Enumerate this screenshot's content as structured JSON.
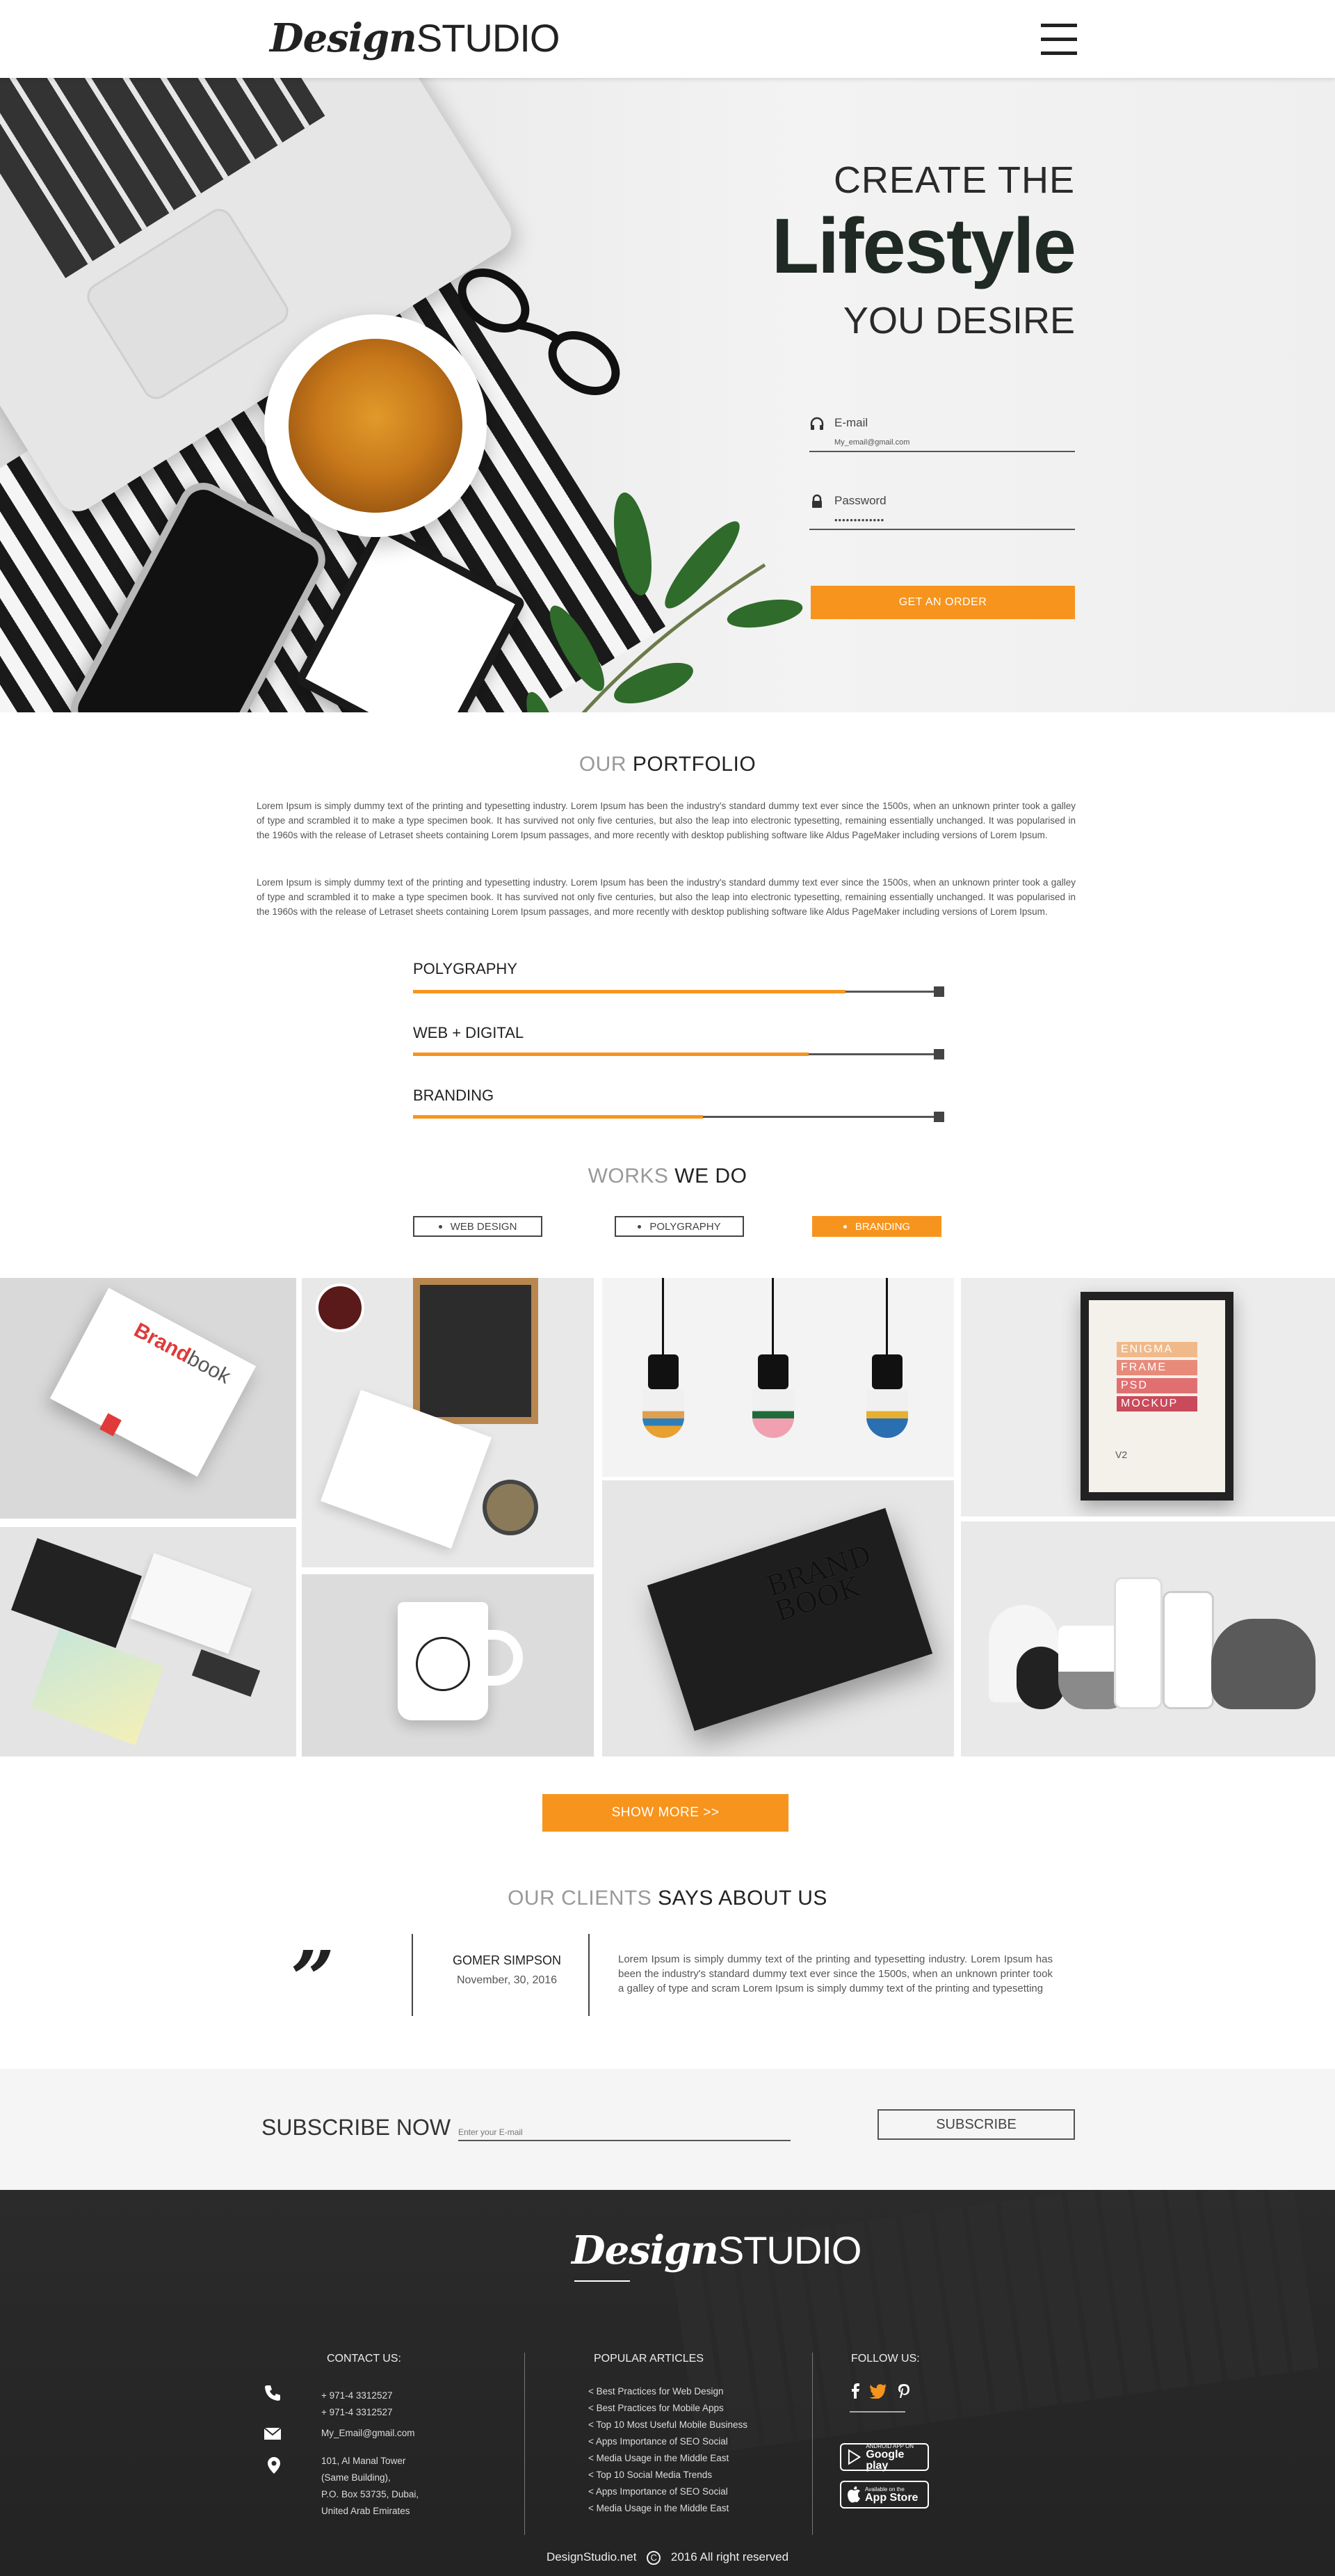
{
  "header": {
    "logo_bold": "Design",
    "logo_thin": "STUDIO"
  },
  "hero": {
    "line1": "CREATE THE",
    "line2": "Lifestyle",
    "line3": "YOU DESIRE",
    "email_label": "E-mail",
    "email_value": "My_email@gmail.com",
    "password_label": "Password",
    "password_value": "•••••••••••••",
    "cta": "GET AN ORDER"
  },
  "portfolio": {
    "title_light": "OUR",
    "title_bold": "PORTFOLIO",
    "para1": "Lorem Ipsum is simply dummy text of the printing and typesetting industry. Lorem Ipsum has been the industry's standard dummy text ever since the 1500s, when an unknown printer took a galley of type and scrambled it to make a type specimen book. It has survived not only five centuries, but also the leap into electronic typesetting, remaining essentially unchanged. It was popularised in the 1960s with the release of Letraset sheets containing Lorem Ipsum passages, and more recently with desktop publishing software like Aldus PageMaker including versions of Lorem Ipsum.",
    "para2": "Lorem Ipsum is simply dummy text of the printing and typesetting industry. Lorem Ipsum has been the industry's standard dummy text ever since the 1500s, when an unknown printer took a galley of type and scrambled it to make a type specimen book. It has survived not only five centuries, but also the leap into electronic typesetting, remaining essentially unchanged. It was popularised in the 1960s with the release of Letraset sheets containing Lorem Ipsum passages, and more recently with desktop publishing software like Aldus PageMaker including versions of Lorem Ipsum.",
    "skills": [
      {
        "label": "POLYGRAPHY",
        "level": 0.82
      },
      {
        "label": "WEB + DIGITAL",
        "level": 0.75
      },
      {
        "label": "BRANDING",
        "level": 0.55
      }
    ]
  },
  "works": {
    "title_light": "WORKS",
    "title_bold": "WE DO",
    "filters": [
      "WEB DESIGN",
      "POLYGRAPHY",
      "BRANDING"
    ],
    "active_filter": "BRANDING",
    "show_more": "SHOW MORE  >>",
    "brandbook_word1": "Brand",
    "brandbook_word2": "book",
    "brand_book_cover": "BRAND BOOK",
    "mockup_words": [
      "ENIGMA",
      "FRAME",
      "PSD",
      "MOCKUP"
    ],
    "mockup_version": "V2"
  },
  "testimonials": {
    "title_light": "OUR CLIENTS",
    "title_bold": "SAYS ABOUT US",
    "quote_mark": "”",
    "name": "GOMER SIMPSON",
    "date": "November, 30, 2016",
    "text": "Lorem Ipsum is simply dummy text of the printing and typesetting industry. Lorem Ipsum has been the industry's standard dummy text ever since the 1500s, when an unknown printer took a galley of type and scram Lorem Ipsum is simply dummy text of the printing and typesetting"
  },
  "subscribe": {
    "title": "SUBSCRIBE NOW",
    "placeholder": "Enter your E-mail",
    "button": "SUBSCRIBE"
  },
  "footer": {
    "logo_bold": "Design",
    "logo_thin": "STUDIO",
    "contact_head": "CONTACT US:",
    "phone1": "+ 971-4 3312527",
    "phone2": "+ 971-4 3312527",
    "email": "My_Email@gmail.com",
    "address": [
      "101, Al Manal Tower",
      "(Same Building),",
      "P.O. Box 53735, Dubai,",
      "United Arab Emirates"
    ],
    "articles_head": "POPULAR ARTICLES",
    "articles": [
      "< Best Practices for Web Design",
      "< Best Practices for Mobile Apps",
      "< Top 10 Most Useful Mobile Business",
      "< Apps Importance of SEO Social",
      "< Media Usage in the Middle East",
      "< Top 10 Social Media Trends",
      "< Apps Importance of SEO Social",
      "< Media Usage in the Middle East"
    ],
    "follow_head": "FOLLOW US:",
    "google_small": "ANDROID APP ON",
    "google_big": "Google play",
    "apple_small": "Available on the",
    "apple_big": "App Store",
    "copyright_site": "DesignStudio.net",
    "copyright_rest": "2016 All right reserved"
  },
  "colors": {
    "accent": "#f7941d",
    "dark": "#222222",
    "footer_bg": "#2b2b2b"
  }
}
